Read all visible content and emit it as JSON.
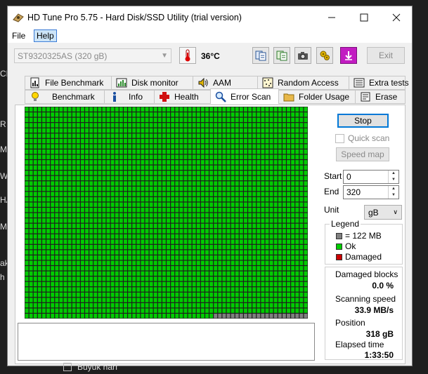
{
  "window": {
    "title": "HD Tune Pro 5.75 - Hard Disk/SSD Utility (trial version)"
  },
  "menu": {
    "file": "File",
    "help": "Help"
  },
  "toolbar": {
    "drive": "ST9320325AS (320 gB)",
    "temperature": "36°C",
    "exit": "Exit"
  },
  "tabs_top": [
    {
      "label": "File Benchmark",
      "icon": "file-benchmark-icon"
    },
    {
      "label": "Disk monitor",
      "icon": "disk-monitor-icon"
    },
    {
      "label": "AAM",
      "icon": "speaker-icon"
    },
    {
      "label": "Random Access",
      "icon": "random-access-icon"
    },
    {
      "label": "Extra tests",
      "icon": "extra-tests-icon"
    }
  ],
  "tabs_bottom": [
    {
      "label": "Benchmark",
      "icon": "bulb-icon"
    },
    {
      "label": "Info",
      "icon": "info-icon"
    },
    {
      "label": "Health",
      "icon": "health-cross-icon"
    },
    {
      "label": "Error Scan",
      "icon": "magnifier-icon",
      "active": true
    },
    {
      "label": "Folder Usage",
      "icon": "folder-icon"
    },
    {
      "label": "Erase",
      "icon": "erase-icon"
    }
  ],
  "scan": {
    "stop": "Stop",
    "quick_scan": "Quick scan",
    "speed_map": "Speed map",
    "start_label": "Start",
    "start_value": "0",
    "end_label": "End",
    "end_value": "320",
    "unit_label": "Unit",
    "unit_value": "gB",
    "blocks_total": 2640,
    "blocks_scanned": 2618
  },
  "legend": {
    "title": "Legend",
    "block_size": "= 122 MB",
    "ok": "Ok",
    "damaged": "Damaged",
    "colors": {
      "unscanned": "#808080",
      "ok": "#00cc00",
      "damaged": "#cc0000"
    }
  },
  "stats": {
    "damaged_blocks_label": "Damaged blocks",
    "damaged_blocks_value": "0.0 %",
    "scanning_speed_label": "Scanning speed",
    "scanning_speed_value": "33.9 MB/s",
    "position_label": "Position",
    "position_value": "318 gB",
    "elapsed_label": "Elapsed time",
    "elapsed_value": "1:33:50"
  },
  "background": {
    "bottom_checkbox_label": "Büyük harf"
  }
}
